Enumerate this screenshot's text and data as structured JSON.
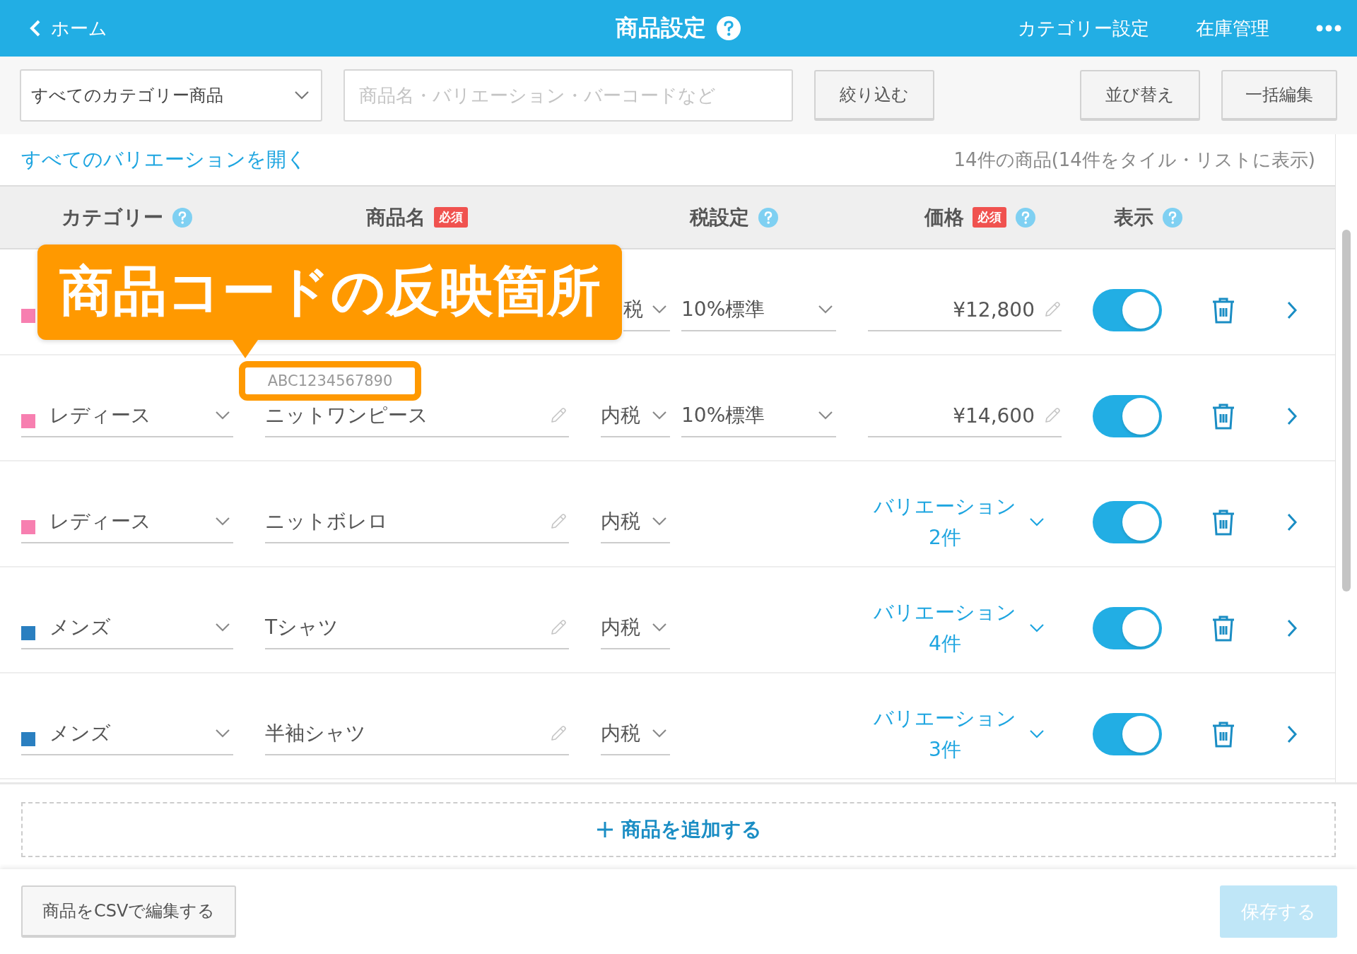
{
  "header": {
    "back_label": "ホーム",
    "title": "商品設定",
    "nav_links": [
      "カテゴリー設定",
      "在庫管理"
    ]
  },
  "toolbar": {
    "category_select": "すべてのカテゴリー商品",
    "search": {
      "placeholder": "商品名・バリエーション・バーコードなど"
    },
    "filter_button": "絞り込む",
    "sort_button": "並び替え",
    "bulk_edit_button": "一括編集"
  },
  "expand_link": "すべてのバリエーションを開く",
  "count_text": "14件の商品(14件をタイル・リストに表示)",
  "table": {
    "columns": [
      {
        "label": "カテゴリー",
        "help": true
      },
      {
        "label": "商品名",
        "badge": "必須",
        "help": false
      },
      {
        "label": "税設定",
        "help": true
      },
      {
        "label": "価格",
        "badge": "必須",
        "help": true
      },
      {
        "label": "表示",
        "help": true
      }
    ],
    "rows": [
      {
        "kind": "price",
        "color": "#f77fb0",
        "tax": "税",
        "rate": "10%標準",
        "price": "¥12,800",
        "visible": true
      },
      {
        "kind": "price",
        "color": "#f77fb0",
        "category": "レディース",
        "name": "ニットワンピース",
        "tax": "内税",
        "rate": "10%標準",
        "price": "¥14,600",
        "visible": true
      },
      {
        "kind": "variations",
        "color": "#f77fb0",
        "category": "レディース",
        "name": "ニットボレロ",
        "tax": "内税",
        "variation_label": "バリエーション",
        "variation_count": "2件",
        "visible": true
      },
      {
        "kind": "variations",
        "color": "#2a7fc0",
        "category": "メンズ",
        "name": "Tシャツ",
        "tax": "内税",
        "variation_label": "バリエーション",
        "variation_count": "4件",
        "visible": true
      },
      {
        "kind": "variations",
        "color": "#2a7fc0",
        "category": "メンズ",
        "name": "半袖シャツ",
        "tax": "内税",
        "variation_label": "バリエーション",
        "variation_count": "3件",
        "visible": true
      }
    ]
  },
  "callout": {
    "text": "商品コードの反映箇所",
    "code": "ABC1234567890"
  },
  "add_button": "商品を追加する",
  "footer": {
    "csv_button": "商品をCSVで編集する",
    "save_button": {
      "label": "保存する",
      "disabled": true
    }
  }
}
